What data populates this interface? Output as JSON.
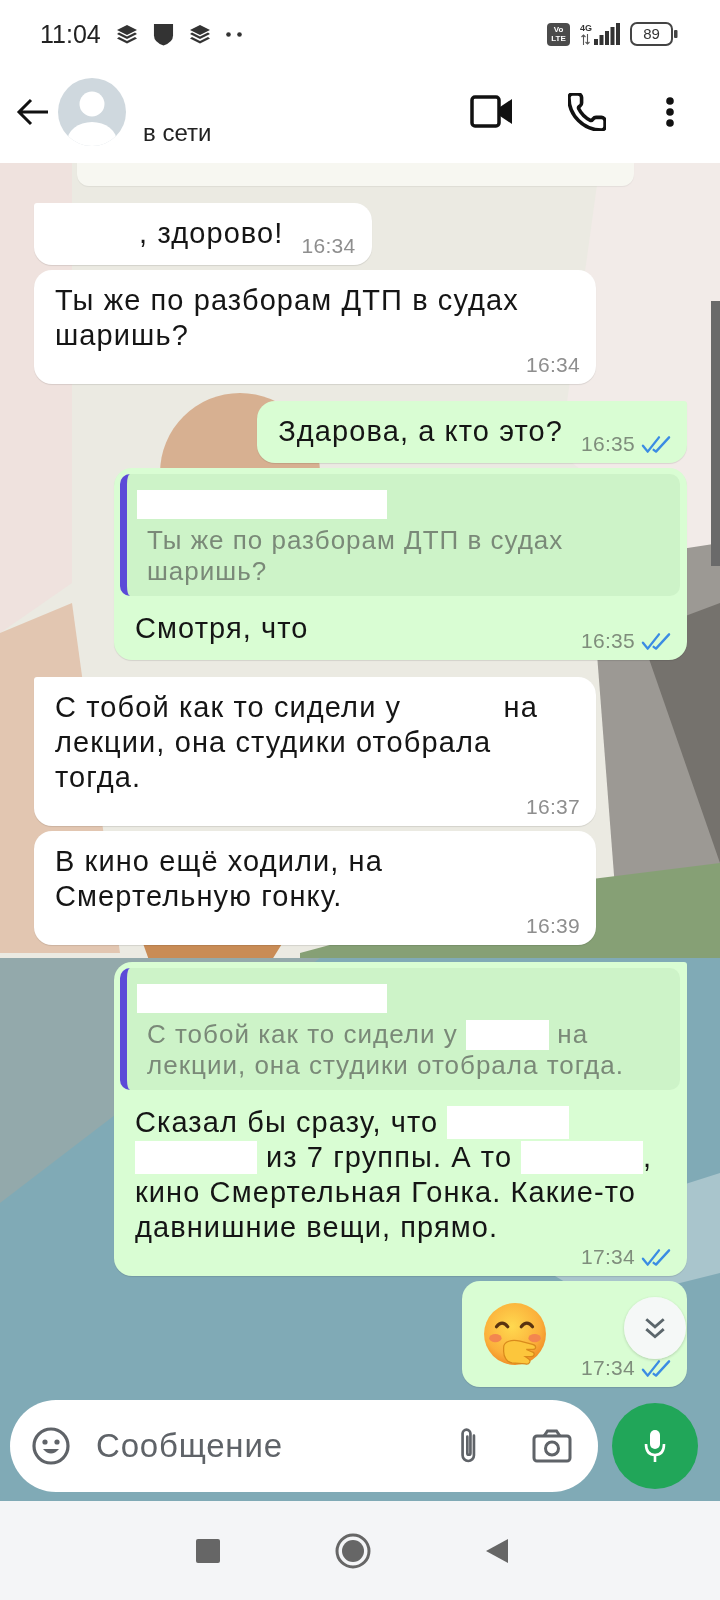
{
  "status_bar": {
    "time": "11:04",
    "volte": [
      "Vo",
      "LTE"
    ],
    "network": "4G",
    "battery": "89"
  },
  "header": {
    "status": "в сети"
  },
  "messages": [
    {
      "kind": "notice"
    },
    {
      "kind": "text",
      "outgoing": false,
      "parts": [
        {
          "kind": "gap"
        },
        {
          "kind": "text",
          "text": ", здорово!"
        }
      ],
      "time": "16:34"
    },
    {
      "kind": "text",
      "outgoing": false,
      "parts": [
        {
          "kind": "text",
          "text": "Ты же по разборам ДТП в судах шаришь?"
        }
      ],
      "time": "16:34"
    },
    {
      "kind": "text",
      "outgoing": true,
      "parts": [
        {
          "kind": "text",
          "text": "Здарова, а кто это?"
        }
      ],
      "time": "16:35",
      "read": true
    },
    {
      "kind": "text",
      "outgoing": true,
      "quote": {
        "author_redacted": true,
        "parts": [
          {
            "kind": "text",
            "text": "Ты же по разборам ДТП в судах шаришь?"
          }
        ]
      },
      "parts": [
        {
          "kind": "text",
          "text": "Смотря, что"
        }
      ],
      "time": "16:35",
      "read": true
    },
    {
      "kind": "text",
      "outgoing": false,
      "parts": [
        {
          "kind": "text",
          "text": "С тобой как то сидели у "
        },
        {
          "kind": "gap"
        },
        {
          "kind": "text",
          "text": " на лекции, она студики отобрала тогда."
        }
      ],
      "time": "16:37"
    },
    {
      "kind": "text",
      "outgoing": false,
      "parts": [
        {
          "kind": "text",
          "text": "В кино ещё ходили, на Смертельную гонку."
        }
      ],
      "time": "16:39"
    },
    {
      "kind": "text",
      "outgoing": true,
      "quote": {
        "author_redacted": true,
        "parts": [
          {
            "kind": "text",
            "text": "С тобой как то сидели у "
          },
          {
            "kind": "redacted"
          },
          {
            "kind": "text",
            "text": " на лекции, она студики отобрала тогда."
          }
        ]
      },
      "parts": [
        {
          "kind": "text",
          "text": "Сказал бы сразу, что "
        },
        {
          "kind": "redacted"
        },
        {
          "kind": "redacted"
        },
        {
          "kind": "text",
          "text": " из 7 группы. А то "
        },
        {
          "kind": "redacted"
        },
        {
          "kind": "text",
          "text": ", кино Смертельная Гонка. Какие-то давнишние вещи, прямо."
        }
      ],
      "time": "17:34",
      "read": true
    },
    {
      "kind": "emoji",
      "outgoing": true,
      "time": "17:34",
      "read": true
    }
  ],
  "composer": {
    "placeholder": "Сообщение"
  }
}
